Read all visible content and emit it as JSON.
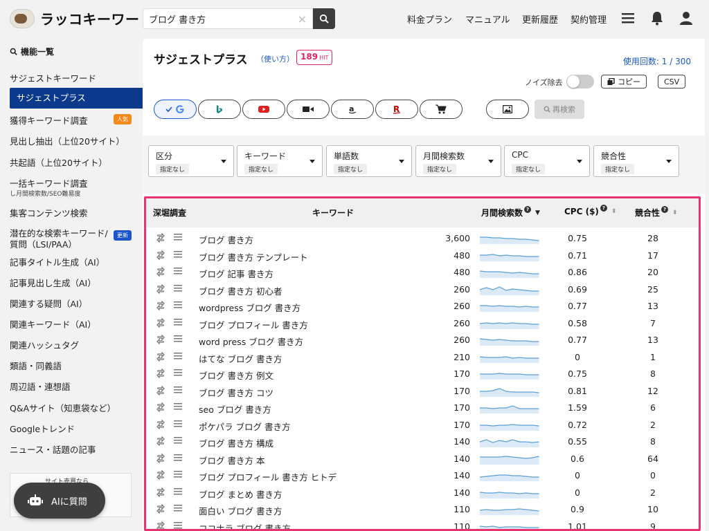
{
  "app": {
    "logo_text": "ラッコキーワード",
    "search": {
      "value": "ブログ 書き方",
      "clear": "×"
    },
    "nav": [
      "料金プラン",
      "マニュアル",
      "更新履歴",
      "契約管理"
    ],
    "icons": {
      "menu": "hamburger-menu-icon",
      "bell": "bell-icon",
      "user": "user-icon",
      "search": "search-icon"
    }
  },
  "sidebar": {
    "heading": "機能一覧",
    "items": [
      {
        "label": "サジェストキーワード"
      },
      {
        "label": "サジェストプラス",
        "active": true
      },
      {
        "label": "獲得キーワード調査",
        "badge": "人気"
      },
      {
        "label": "見出し抽出（上位20サイト）"
      },
      {
        "label": "共起語（上位20サイト）"
      },
      {
        "label": "一括キーワード調査",
        "sub": "し月間検索数/SEO難易度"
      },
      {
        "label": "集客コンテンツ検索"
      },
      {
        "label": "潜在的な検索キーワード/",
        "label2": "質問（LSI/PAA）",
        "badge": "更新"
      },
      {
        "label": "記事タイトル生成（AI）"
      },
      {
        "label": "記事見出し生成（AI）"
      },
      {
        "label": "関連する疑問（AI）"
      },
      {
        "label": "関連キーワード（AI）"
      },
      {
        "label": "関連ハッシュタグ"
      },
      {
        "label": "類語・同義語"
      },
      {
        "label": "周辺語・連想語"
      },
      {
        "label": "Q&Aサイト（知恵袋など）"
      },
      {
        "label": "Googleトレンド"
      },
      {
        "label": "ニュース・話題の記事"
      }
    ],
    "promo_text": "サイト売買なら",
    "ai_button": "AIに質問"
  },
  "main": {
    "title": "サジェストプラス",
    "howto": "（使い方）",
    "hit_count": "189",
    "hit_unit": "HIT",
    "usage": "使用回数: 1 / 300",
    "noise_label": "ノイズ除去",
    "noise_enabled": false,
    "copy_label": "コピー",
    "csv_label": "CSV",
    "research_label": "再検索",
    "engines": [
      {
        "name": "google-icon",
        "active": true
      },
      {
        "name": "bing-icon"
      },
      {
        "name": "youtube-icon"
      },
      {
        "name": "video-icon"
      },
      {
        "name": "amazon-icon"
      },
      {
        "name": "rakuten-icon"
      },
      {
        "name": "shopping-cart-icon"
      },
      {
        "name": "image-icon"
      }
    ],
    "filters": [
      {
        "label": "区分",
        "value": "指定なし"
      },
      {
        "label": "キーワード",
        "value": "指定なし"
      },
      {
        "label": "単語数",
        "value": "指定なし"
      },
      {
        "label": "月間検索数",
        "value": "指定なし"
      },
      {
        "label": "CPC",
        "value": "指定なし"
      },
      {
        "label": "競合性",
        "value": "指定なし"
      }
    ],
    "columns": {
      "dig": "深堀調査",
      "keyword": "キーワード",
      "volume": "月間検索数",
      "cpc": "CPC ($)",
      "competition": "競合性"
    },
    "rows": [
      {
        "keyword": "ブログ 書き方",
        "volume": "3,600",
        "cpc": "0.75",
        "comp": "28"
      },
      {
        "keyword": "ブログ 書き方 テンプレート",
        "volume": "480",
        "cpc": "0.71",
        "comp": "17"
      },
      {
        "keyword": "ブログ 記事 書き方",
        "volume": "480",
        "cpc": "0.86",
        "comp": "20"
      },
      {
        "keyword": "ブログ 書き方 初心者",
        "volume": "260",
        "cpc": "0.69",
        "comp": "25"
      },
      {
        "keyword": "wordpress ブログ 書き方",
        "volume": "260",
        "cpc": "0.77",
        "comp": "13"
      },
      {
        "keyword": "ブログ プロフィール 書き方",
        "volume": "260",
        "cpc": "0.58",
        "comp": "7"
      },
      {
        "keyword": "word press ブログ 書き方",
        "volume": "260",
        "cpc": "0.77",
        "comp": "13"
      },
      {
        "keyword": "はてな ブログ 書き方",
        "volume": "210",
        "cpc": "0",
        "comp": "1"
      },
      {
        "keyword": "ブログ 書き方 例文",
        "volume": "170",
        "cpc": "0.75",
        "comp": "8"
      },
      {
        "keyword": "ブログ 書き方 コツ",
        "volume": "170",
        "cpc": "0.81",
        "comp": "12"
      },
      {
        "keyword": "seo ブログ 書き方",
        "volume": "170",
        "cpc": "1.59",
        "comp": "6"
      },
      {
        "keyword": "ポケパラ ブログ 書き方",
        "volume": "170",
        "cpc": "0.72",
        "comp": "2"
      },
      {
        "keyword": "ブログ 書き方 構成",
        "volume": "140",
        "cpc": "0.55",
        "comp": "8"
      },
      {
        "keyword": "ブログ 書き方 本",
        "volume": "140",
        "cpc": "0.6",
        "comp": "64"
      },
      {
        "keyword": "ブログ プロフィール 書き方 ヒトデ",
        "volume": "140",
        "cpc": "0",
        "comp": "0"
      },
      {
        "keyword": "ブログ まとめ 書き方",
        "volume": "140",
        "cpc": "0",
        "comp": "2"
      },
      {
        "keyword": "面白い ブログ 書き方",
        "volume": "110",
        "cpc": "0.9",
        "comp": "10"
      },
      {
        "keyword": "ココナラ ブログ 書き方",
        "volume": "110",
        "cpc": "1.01",
        "comp": "9"
      }
    ],
    "colors": {
      "accent": "#0b3a8c",
      "link": "#1a56c9",
      "highlight": "#e8336e",
      "spark": "#5a9fd6"
    }
  }
}
